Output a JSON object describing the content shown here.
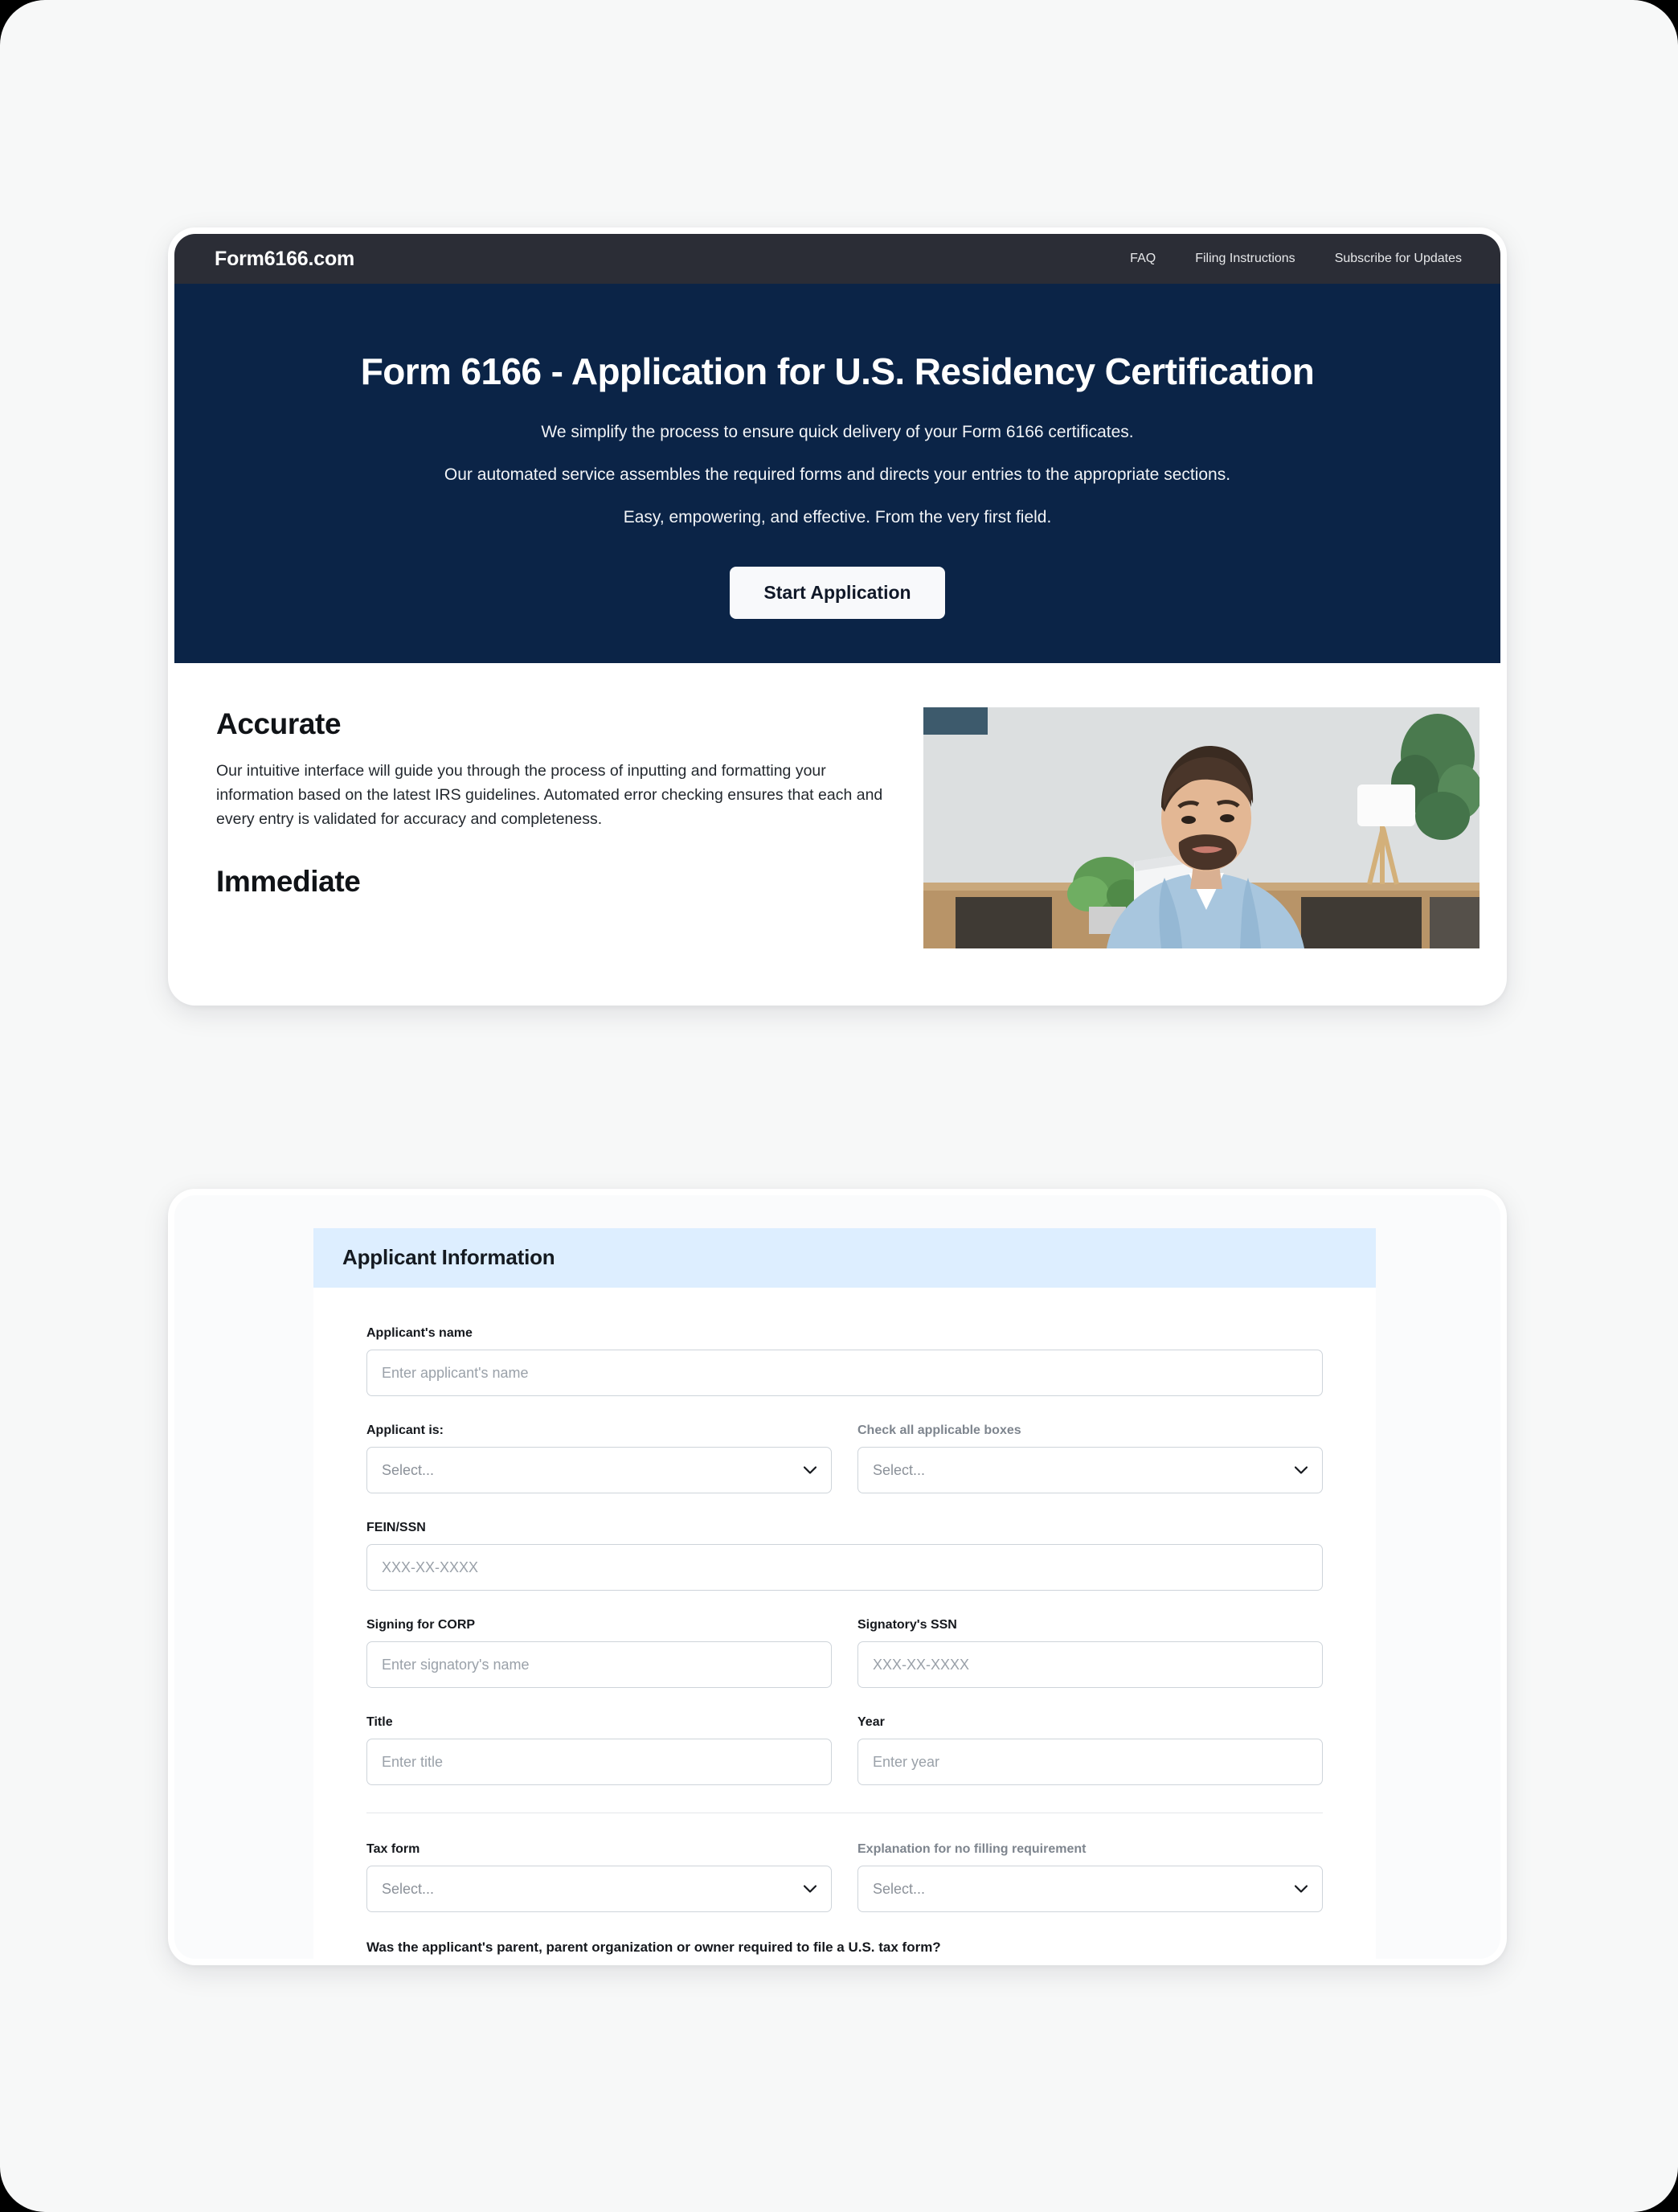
{
  "nav": {
    "brand": "Form6166.com",
    "links": [
      {
        "label": "FAQ"
      },
      {
        "label": "Filing Instructions"
      },
      {
        "label": "Subscribe for Updates"
      }
    ]
  },
  "hero": {
    "title": "Form 6166 - Application for U.S. Residency Certification",
    "sub1": "We simplify the process to ensure quick delivery of your Form 6166 certificates.",
    "sub2": "Our automated service assembles the required forms and directs your entries to the appropriate sections.",
    "sub3": "Easy, empowering, and effective. From the very first field.",
    "cta_label": "Start Application",
    "bg_color": "#0b2447"
  },
  "features": {
    "accurate_heading": "Accurate",
    "accurate_body": "Our intuitive interface will guide you through the process of inputting and formatting your information based on the latest IRS guidelines. Automated error checking ensures that each and every entry is validated for accuracy and completeness.",
    "immediate_heading": "Immediate"
  },
  "form": {
    "section_title": "Applicant Information",
    "section_header_color": "#ddeeff",
    "applicant_name": {
      "label": "Applicant's name",
      "placeholder": "Enter applicant's name",
      "value": ""
    },
    "applicant_is": {
      "label": "Applicant is:",
      "placeholder": "Select...",
      "value": "Select..."
    },
    "check_boxes": {
      "label": "Check all applicable boxes",
      "placeholder": "Select...",
      "value": "Select..."
    },
    "fein_ssn": {
      "label": "FEIN/SSN",
      "placeholder": "XXX-XX-XXXX",
      "value": ""
    },
    "signing_for_corp": {
      "label": "Signing for CORP",
      "placeholder": "Enter signatory's name",
      "value": ""
    },
    "signatory_ssn": {
      "label": "Signatory's SSN",
      "placeholder": "XXX-XX-XXXX",
      "value": ""
    },
    "title": {
      "label": "Title",
      "placeholder": "Enter title",
      "value": ""
    },
    "year": {
      "label": "Year",
      "placeholder": "Enter year",
      "value": ""
    },
    "tax_form": {
      "label": "Tax form",
      "placeholder": "Select...",
      "value": "Select..."
    },
    "explanation": {
      "label": "Explanation for no filling requirement",
      "placeholder": "Select...",
      "value": "Select..."
    },
    "parent_question": "Was the applicant's parent, parent organization or owner required to file a U.S. tax form?"
  },
  "icons": {
    "chevron_down": "chevron-down-icon"
  }
}
